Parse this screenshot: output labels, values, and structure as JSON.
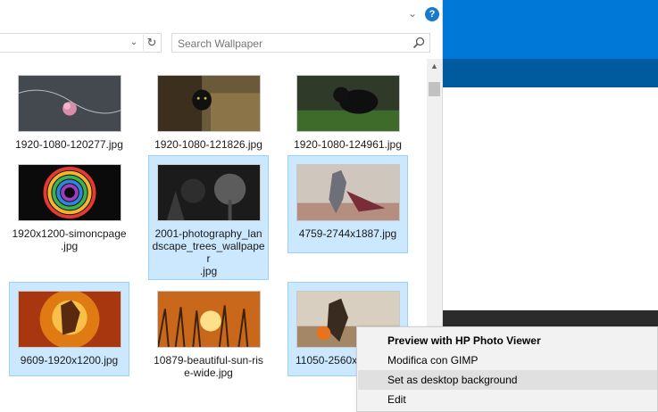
{
  "explorer": {
    "search_placeholder": "Search Wallpaper",
    "files": [
      {
        "name": "1920-1080-120277.jpg",
        "selected": false,
        "icon": "rose-photo"
      },
      {
        "name": "1920-1080-121826.jpg",
        "selected": false,
        "icon": "black-cat-photo"
      },
      {
        "name": "1920-1080-124961.jpg",
        "selected": false,
        "icon": "black-cat-grass-photo"
      },
      {
        "name": "1920x1200-simoncpage.jpg",
        "selected": false,
        "icon": "color-wheel-photo"
      },
      {
        "name": "2001-photography_landscape_trees_wallpaper.jpg",
        "selected": true,
        "icon": "trees-bw-photo"
      },
      {
        "name": "4759-2744x1887.jpg",
        "selected": true,
        "icon": "robot-warrior-photo"
      },
      {
        "name": "9609-1920x1200.jpg",
        "selected": true,
        "icon": "fire-warrior-photo"
      },
      {
        "name": "10879-beautiful-sun-rise-wide.jpg",
        "selected": false,
        "icon": "sunrise-wheat-photo"
      },
      {
        "name": "11050-2560x",
        "selected": true,
        "icon": "fantasy-warrior-photo"
      }
    ],
    "file_labels": {
      "f0": "1920-1080-120277.jpg",
      "f1": "1920-1080-121826.jpg",
      "f2": "1920-1080-124961.jpg",
      "f3_l1": "1920x1200-simoncpage",
      "f3_l2": ".jpg",
      "f4_l1": "2001-photography_lan",
      "f4_l2": "dscape_trees_wallpaper",
      "f4_l3": ".jpg",
      "f5": "4759-2744x1887.jpg",
      "f6": "9609-1920x1200.jpg",
      "f7_l1": "10879-beautiful-sun-ris",
      "f7_l2": "e-wide.jpg",
      "f8": "11050-2560x"
    }
  },
  "context_menu": {
    "items": [
      {
        "label": "Preview with HP Photo Viewer",
        "bold": true
      },
      {
        "label": "Modifica con GIMP",
        "bold": false
      },
      {
        "label": "Set as desktop background",
        "bold": false,
        "highlighted": true
      },
      {
        "label": "Edit",
        "bold": false
      }
    ]
  },
  "colors": {
    "selection_fill": "#cce8ff",
    "selection_border": "#99d1ff",
    "accent_blue": "#0078d7",
    "menu_bg": "#f2f2f2",
    "menu_hover": "#e0e0e0"
  }
}
